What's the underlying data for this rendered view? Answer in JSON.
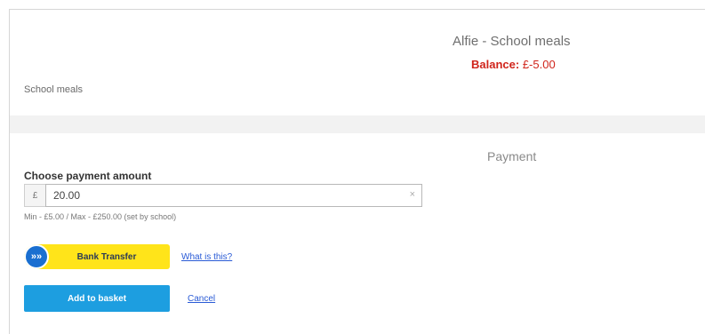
{
  "header": {
    "title": "Alfie - School meals",
    "balance_label": "Balance:",
    "balance_value": "£-5.00",
    "product": "School meals"
  },
  "payment": {
    "heading": "Payment",
    "amount_label": "Choose payment amount",
    "currency_symbol": "£",
    "amount_value": "20.00",
    "clear_icon": "×",
    "hint": "Min - £5.00 / Max - £250.00 (set by school)"
  },
  "bank_transfer": {
    "icon": "»»",
    "label": "Bank Transfer",
    "info_link": "What is this?"
  },
  "actions": {
    "add_to_basket": "Add to basket",
    "cancel": "Cancel"
  },
  "colors": {
    "balance": "#d0241b",
    "bank_transfer_bg": "#ffe41a",
    "bank_transfer_icon": "#1a6fd0",
    "primary_button": "#1d9ee0",
    "link": "#2a5bd6"
  }
}
